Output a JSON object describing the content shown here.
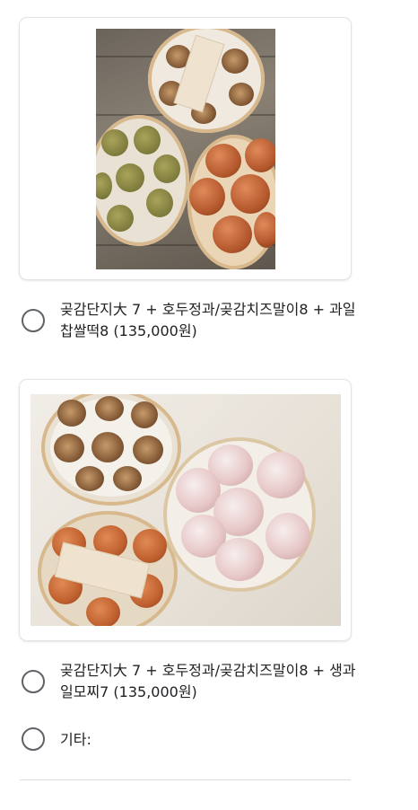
{
  "options": [
    {
      "label": "곶감단지大 7 + 호두정과/곶감치즈말이8 + 과일찹쌀떡8 (135,000원)",
      "selected": false
    },
    {
      "label": "곶감단지大 7 + 호두정과/곶감치즈말이8 + 생과일모찌7 (135,000원)",
      "selected": false
    },
    {
      "label": "기타:",
      "selected": false
    }
  ],
  "colors": {
    "radio_border": "#5f6368",
    "text": "#202124",
    "card_border": "#e3e3e3"
  }
}
